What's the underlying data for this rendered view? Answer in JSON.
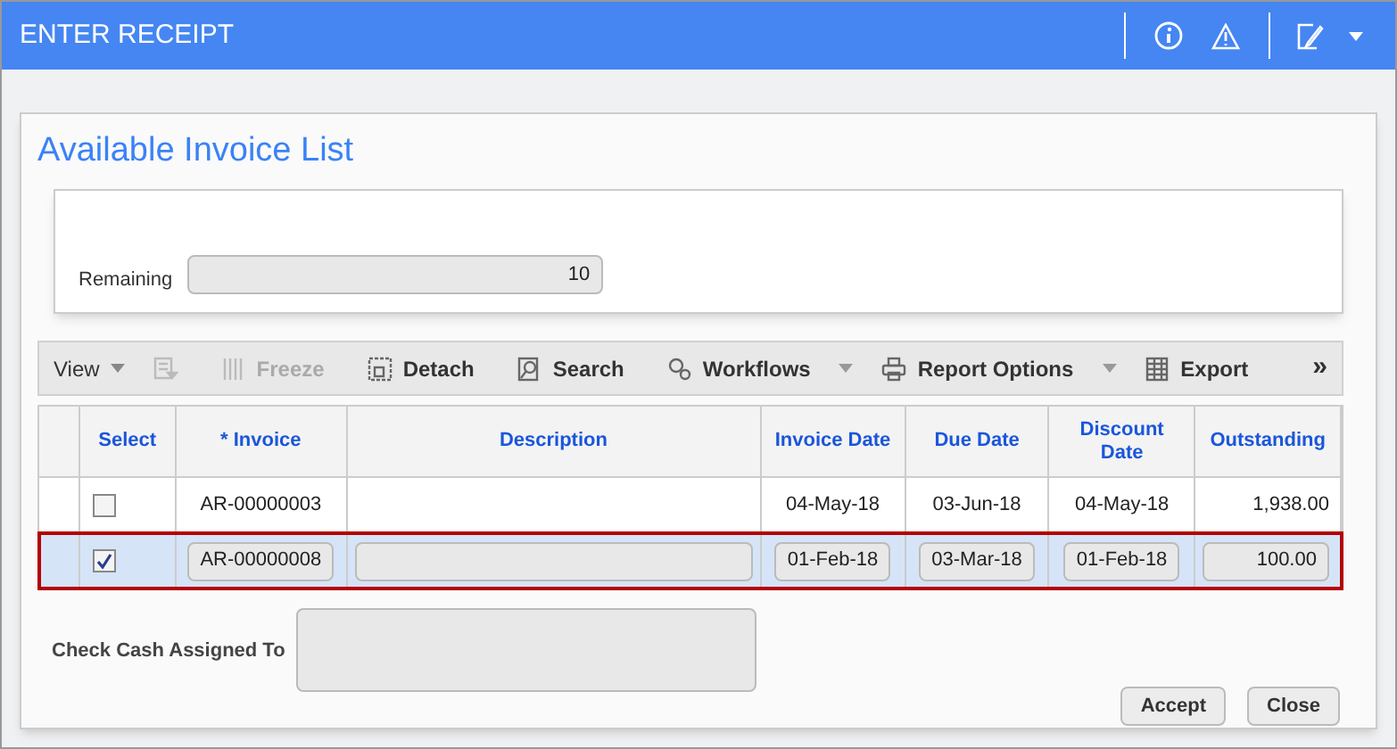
{
  "header": {
    "title": "ENTER RECEIPT"
  },
  "dialog": {
    "title": "Available Invoice List",
    "remaining": {
      "label": "Remaining",
      "value": "10"
    }
  },
  "toolbar": [
    {
      "kind": "menu",
      "label": "View",
      "disabled": false
    },
    {
      "kind": "filter",
      "disabled": true
    },
    {
      "kind": "freeze",
      "label": "Freeze",
      "disabled": true
    },
    {
      "kind": "detach",
      "label": "Detach",
      "disabled": false
    },
    {
      "kind": "search",
      "label": "Search",
      "disabled": false
    },
    {
      "kind": "workflows",
      "label": "Workflows",
      "disabled": false
    },
    {
      "kind": "report",
      "label": "Report Options",
      "disabled": false
    },
    {
      "kind": "export",
      "label": "Export",
      "disabled": false
    },
    {
      "kind": "more",
      "label": "»",
      "disabled": false
    }
  ],
  "table": {
    "columns": [
      "Select",
      "* Invoice",
      "Description",
      "Invoice Date",
      "Due Date",
      "Discount Date",
      "Outstanding"
    ],
    "rows": [
      {
        "selected": false,
        "checked": false,
        "invoice": "AR-00000003",
        "description": "",
        "invoice_date": "04-May-18",
        "due_date": "03-Jun-18",
        "discount_date": "04-May-18",
        "outstanding": "1,938.00"
      },
      {
        "selected": true,
        "checked": true,
        "invoice": "AR-00000008",
        "description": "",
        "invoice_date": "01-Feb-18",
        "due_date": "03-Mar-18",
        "discount_date": "01-Feb-18",
        "outstanding": "100.00"
      }
    ]
  },
  "check_cash": {
    "label": "Check Cash Assigned To"
  },
  "buttons": [
    "Accept",
    "Close"
  ]
}
